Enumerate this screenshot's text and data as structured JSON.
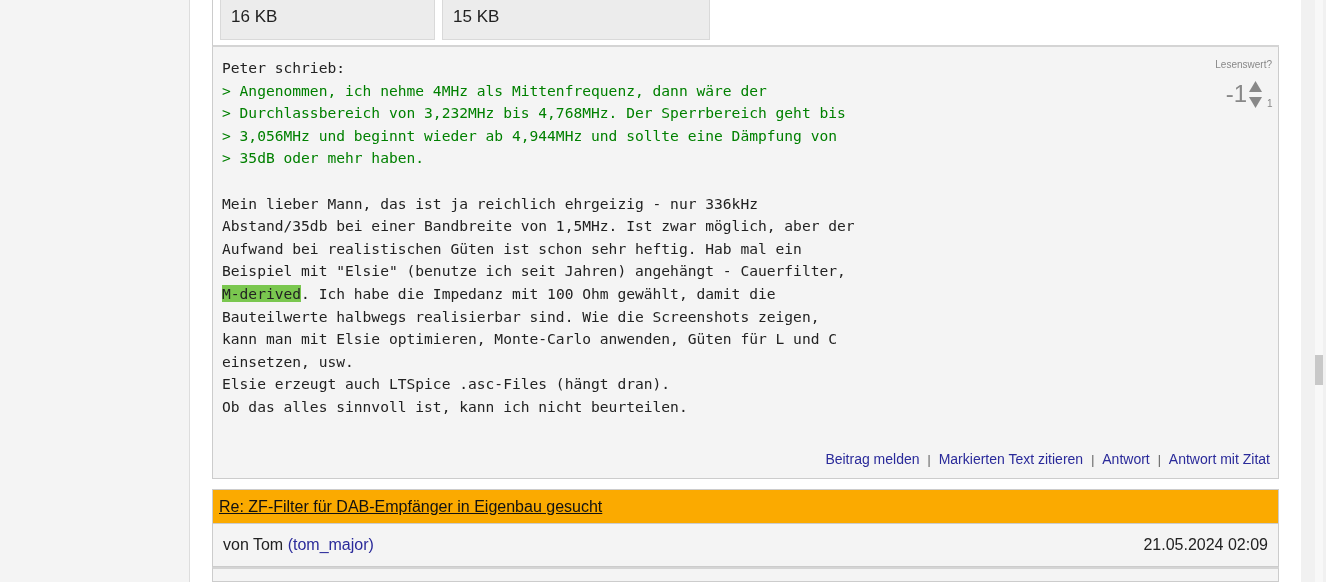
{
  "attachments": [
    {
      "size": "16 KB"
    },
    {
      "size": "15 KB"
    }
  ],
  "post": {
    "rating": {
      "label": "Lesenswert?",
      "score": "-1",
      "down_count": "1"
    },
    "lines": [
      {
        "kind": "plain",
        "segments": [
          {
            "text": "Peter schrieb:",
            "highlighted": false
          }
        ]
      },
      {
        "kind": "quote",
        "segments": [
          {
            "text": "> Angenommen, ich nehme 4MHz als Mittenfrequenz, dann wäre der",
            "highlighted": false
          }
        ]
      },
      {
        "kind": "quote",
        "segments": [
          {
            "text": "> Durchlassbereich von 3,232MHz bis 4,768MHz. Der Sperrbereich geht bis",
            "highlighted": false
          }
        ]
      },
      {
        "kind": "quote",
        "segments": [
          {
            "text": "> 3,056MHz und beginnt wieder ab 4,944MHz und sollte eine Dämpfung von",
            "highlighted": false
          }
        ]
      },
      {
        "kind": "quote",
        "segments": [
          {
            "text": "> 35dB oder mehr haben.",
            "highlighted": false
          }
        ]
      },
      {
        "kind": "blank"
      },
      {
        "kind": "plain",
        "segments": [
          {
            "text": "Mein lieber Mann, das ist ja reichlich ehrgeizig - nur 336kHz",
            "highlighted": false
          }
        ]
      },
      {
        "kind": "plain",
        "segments": [
          {
            "text": "Abstand/35db bei einer Bandbreite von 1,5MHz. Ist zwar möglich, aber der",
            "highlighted": false
          }
        ]
      },
      {
        "kind": "plain",
        "segments": [
          {
            "text": "Aufwand bei realistischen Güten ist schon sehr heftig. Hab mal ein",
            "highlighted": false
          }
        ]
      },
      {
        "kind": "plain",
        "segments": [
          {
            "text": "Beispiel mit \"Elsie\" (benutze ich seit Jahren) angehängt - Cauerfilter,",
            "highlighted": false
          }
        ]
      },
      {
        "kind": "plain",
        "segments": [
          {
            "text": "M-derived",
            "highlighted": true
          },
          {
            "text": ". Ich habe die Impedanz mit 100 Ohm gewählt, damit die",
            "highlighted": false
          }
        ]
      },
      {
        "kind": "plain",
        "segments": [
          {
            "text": "Bauteilwerte halbwegs realisierbar sind. Wie die Screenshots zeigen,",
            "highlighted": false
          }
        ]
      },
      {
        "kind": "plain",
        "segments": [
          {
            "text": "kann man mit Elsie optimieren, Monte-Carlo anwenden, Güten für L und C",
            "highlighted": false
          }
        ]
      },
      {
        "kind": "plain",
        "segments": [
          {
            "text": "einsetzen, usw.",
            "highlighted": false
          }
        ]
      },
      {
        "kind": "plain",
        "segments": [
          {
            "text": "Elsie erzeugt auch LTSpice .asc-Files (hängt dran).",
            "highlighted": false
          }
        ]
      },
      {
        "kind": "plain",
        "segments": [
          {
            "text": "Ob das alles sinnvoll ist, kann ich nicht beurteilen.",
            "highlighted": false
          }
        ]
      }
    ],
    "actions": [
      "Beitrag melden",
      "Markierten Text zitieren",
      "Antwort",
      "Antwort mit Zitat"
    ],
    "separator": "|"
  },
  "next_post": {
    "title": "Re: ZF-Filter für DAB-Empfänger in Eigenbau gesucht",
    "by": "von Tom",
    "author": "(tom_major)",
    "date": "21.05.2024 02:09"
  }
}
